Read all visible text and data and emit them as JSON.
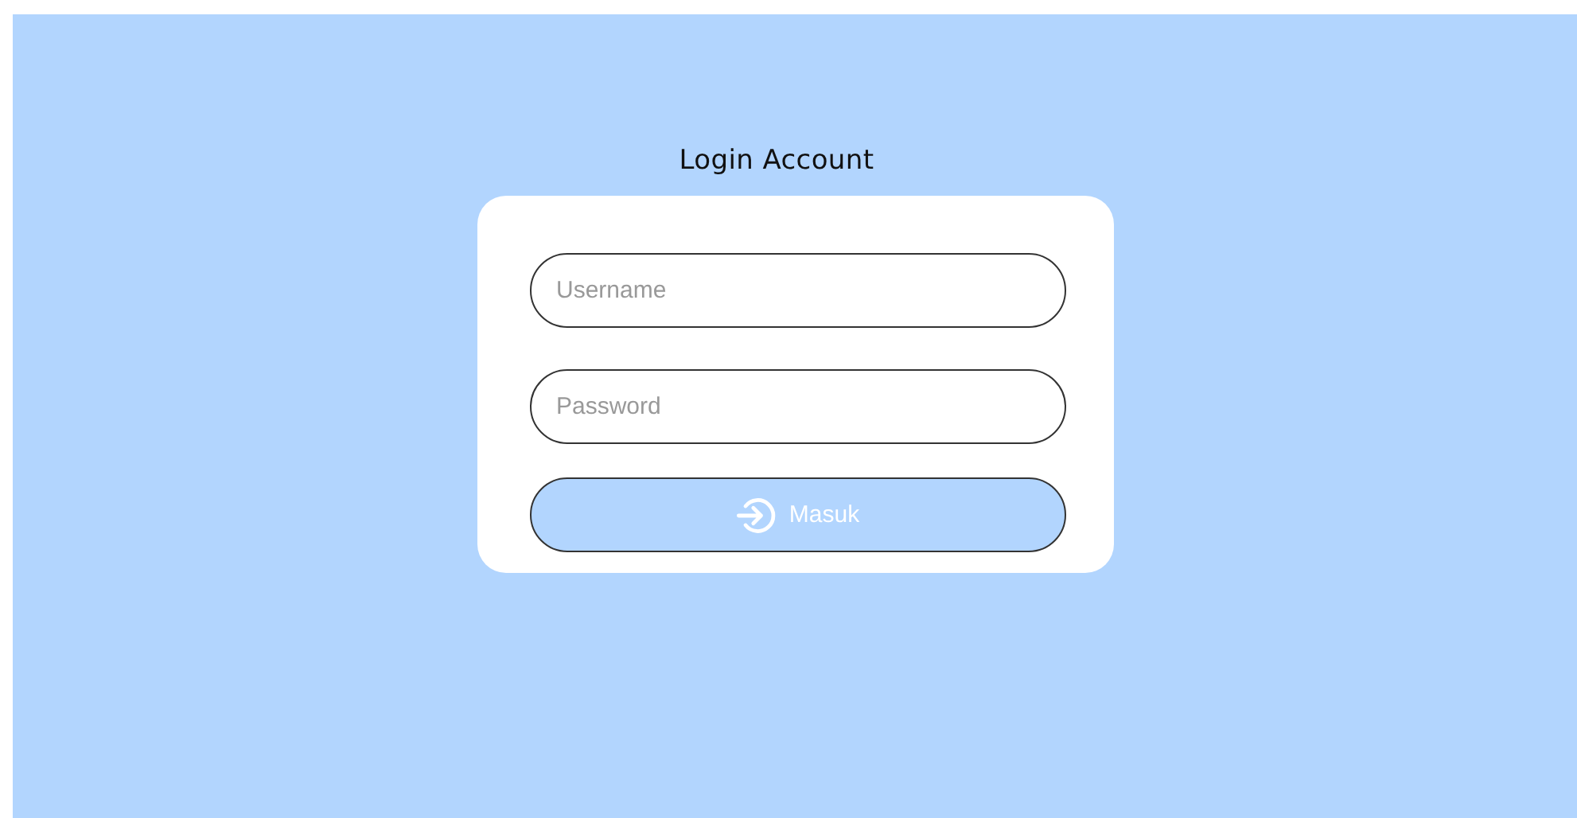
{
  "title": "Login Account",
  "fields": [
    {
      "placeholder": "Username"
    },
    {
      "placeholder": "Password"
    }
  ],
  "button": {
    "label": "Masuk"
  }
}
